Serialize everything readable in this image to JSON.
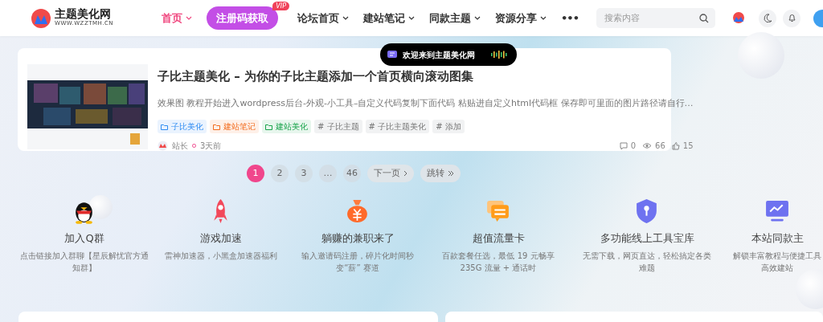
{
  "header": {
    "logo": {
      "name": "主题美化网",
      "site": "WWW.WZZTMH.CN"
    },
    "menu": [
      {
        "label": "首页",
        "selected": true,
        "kind": "dropdown"
      },
      {
        "label": "注册码获取",
        "selected": false,
        "kind": "pill",
        "badge": "VIP"
      },
      {
        "label": "论坛首页",
        "selected": false,
        "kind": "dropdown"
      },
      {
        "label": "建站笔记",
        "selected": false,
        "kind": "dropdown"
      },
      {
        "label": "同款主题",
        "selected": false,
        "kind": "dropdown"
      },
      {
        "label": "资源分享",
        "selected": false,
        "kind": "dropdown"
      },
      {
        "label": "•••",
        "selected": false,
        "kind": "more"
      }
    ],
    "search": {
      "placeholder": "搜索内容"
    }
  },
  "toast": {
    "text": "欢迎来到主题美化网"
  },
  "post": {
    "title": "子比主题美化 – 为你的子比主题添加一个首页横向滚动图集",
    "excerpt": "效果图 教程开始进入wordpress后台-外观-小工具–自定义代码复制下面代码 粘贴进自定义html代码框 保存即可里面的图片路径请自行…",
    "tags": [
      {
        "label": "子比美化",
        "kind": "category",
        "color": "#2f8cf2"
      },
      {
        "label": "建站笔记",
        "kind": "category",
        "color": "#f26b1d"
      },
      {
        "label": "建站美化",
        "kind": "category",
        "color": "#18a34a"
      },
      {
        "label": "# 子比主题",
        "kind": "tag"
      },
      {
        "label": "# 子比主题美化",
        "kind": "tag"
      },
      {
        "label": "# 添加",
        "kind": "tag"
      }
    ],
    "author": "站长",
    "time": "3天前",
    "comments": "0",
    "views": "66",
    "likes": "15"
  },
  "pagination": {
    "pages": [
      {
        "label": "1",
        "selected": true
      },
      {
        "label": "2",
        "selected": false
      },
      {
        "label": "3",
        "selected": false
      },
      {
        "label": "…",
        "selected": false
      },
      {
        "label": "46",
        "selected": false
      }
    ],
    "next": "下一页",
    "jump": "跳转"
  },
  "features": [
    {
      "kind": "penguin",
      "title": "加入Q群",
      "desc": "点击链接加入群聊【星辰解忧官方通知群】"
    },
    {
      "kind": "rocket",
      "title": "游戏加速",
      "desc": "雷神加速器，小黑盒加速器福利"
    },
    {
      "kind": "moneybag",
      "title": "躺赚的兼职来了",
      "desc": "输入邀请码注册，碎片化时间秒变“薪” 赛道"
    },
    {
      "kind": "chat",
      "title": "超值流量卡",
      "desc": "百款套餐任选，最低 19 元畅享 235G 流量 + 通话时"
    },
    {
      "kind": "shield",
      "title": "多功能线上工具宝库",
      "desc": "无需下载，网页直达，轻松搞定各类难题"
    },
    {
      "kind": "monitor",
      "title": "本站同款主",
      "desc": "解锁丰富教程与便捷工具高效建站"
    }
  ]
}
